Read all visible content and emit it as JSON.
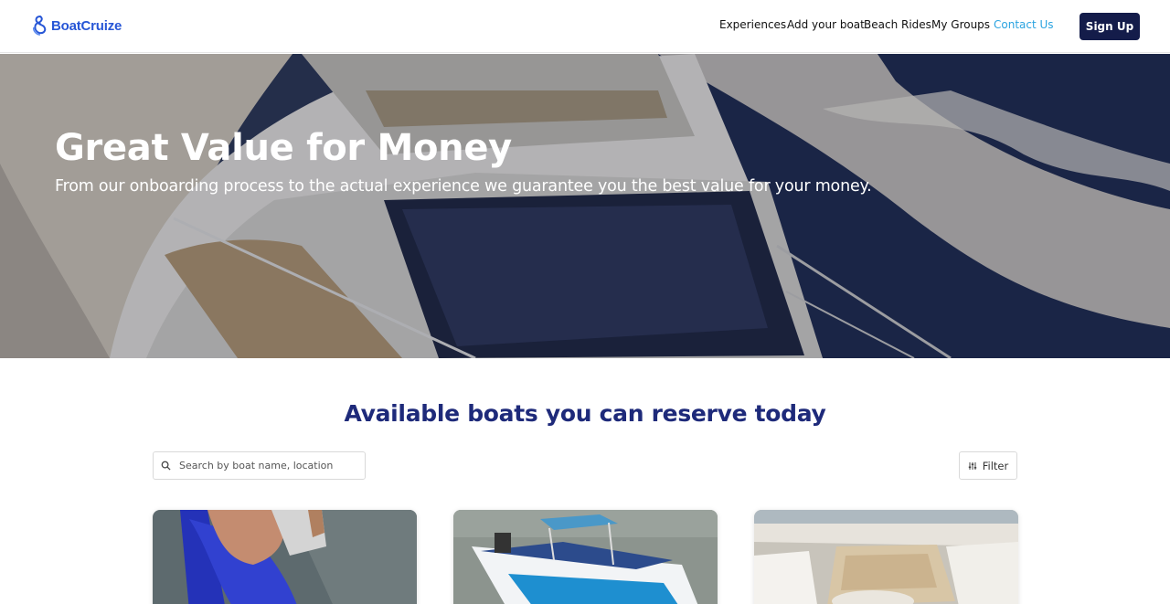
{
  "brand": {
    "name": "BoatCruize",
    "logo_icon": "boat-logo-icon",
    "color": "#2756d6"
  },
  "nav": {
    "items": [
      {
        "label": "Experiences",
        "active": false
      },
      {
        "label": "Add your boat",
        "active": false
      },
      {
        "label": "Beach Rides",
        "active": false
      },
      {
        "label": "My Groups",
        "active": false
      },
      {
        "label": "Contact Us",
        "active": true
      }
    ],
    "active_color": "#2aa3e0",
    "signup_label": "Sign Up",
    "signup_color": "#141c4a"
  },
  "hero": {
    "title": "Great Value for Money",
    "subtitle": "From our onboarding process to the actual experience we guarantee you the best value for your money."
  },
  "listing": {
    "title": "Available boats you can reserve today",
    "title_color": "#1e2a7a",
    "search_placeholder": "Search by boat name, location",
    "search_icon": "search-icon",
    "filter_label": "Filter",
    "filter_icon": "filter-icon",
    "cards": [
      {
        "image": "jet-ski-photo"
      },
      {
        "image": "speedboat-photo"
      },
      {
        "image": "yacht-interior-photo"
      }
    ]
  }
}
